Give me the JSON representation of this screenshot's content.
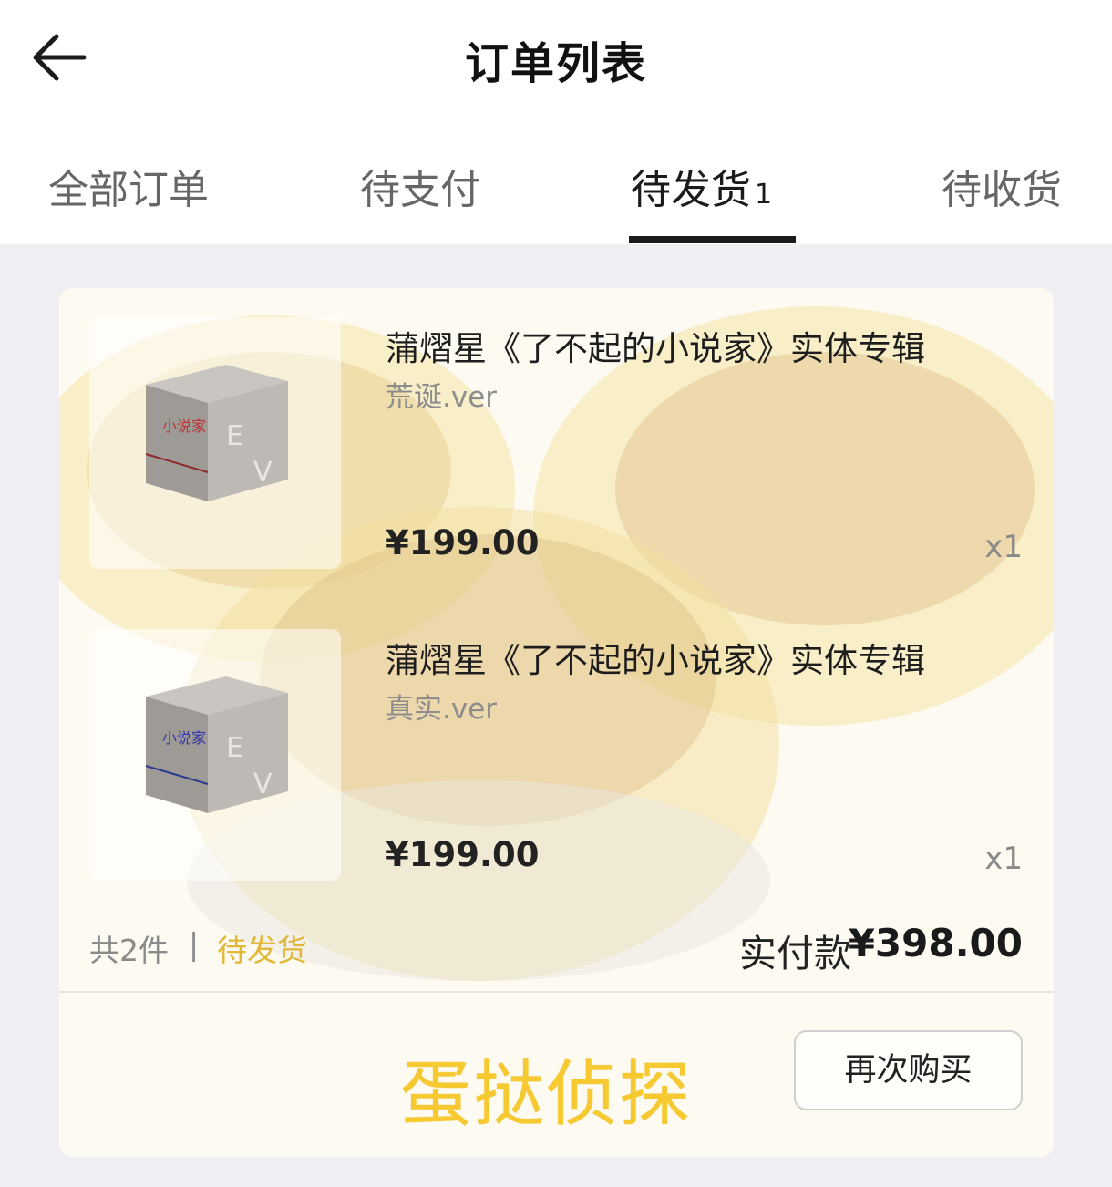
{
  "header": {
    "back_icon": "arrow-left-icon",
    "title": "订单列表"
  },
  "tabs": [
    {
      "label": "全部订单",
      "active": false
    },
    {
      "label": "待支付",
      "active": false
    },
    {
      "label": "待发货",
      "count": "1",
      "active": true
    },
    {
      "label": "待收货",
      "active": false
    }
  ],
  "order": {
    "items": [
      {
        "name": "蒲熠星《了不起的小说家》实体专辑",
        "variant": "荒诞.ver",
        "price": "¥199.00",
        "qty": "x1"
      },
      {
        "name": "蒲熠星《了不起的小说家》实体专辑",
        "variant": "真实.ver",
        "price": "¥199.00",
        "qty": "x1"
      }
    ],
    "count_text": "共2件",
    "separator": "|",
    "status": "待发货",
    "total_label": "实付款",
    "total_value": "¥398.00",
    "brand_text": "蛋挞侦探",
    "rebuy_label": "再次购买"
  },
  "colors": {
    "accent_status": "#e2b733",
    "brand_yellow": "#f5c92f",
    "background": "#efeff3"
  }
}
